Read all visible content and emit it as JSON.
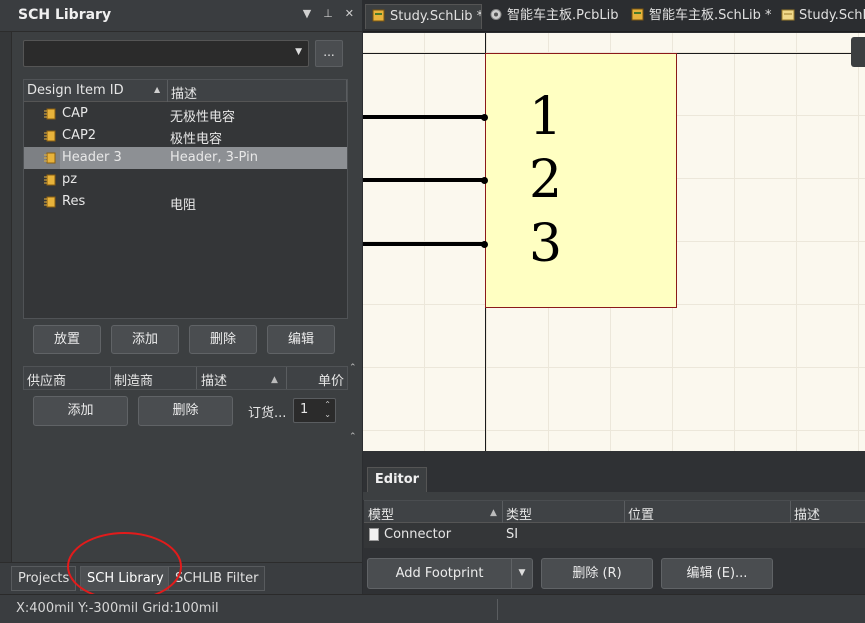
{
  "panel": {
    "title": "SCH Library",
    "title_icons": [
      "chevron-down-icon",
      "pin-icon",
      "close-icon"
    ],
    "filter_value": "",
    "browse_label": "...",
    "grid": {
      "headers": [
        "Design Item ID",
        "描述"
      ],
      "rows": [
        {
          "id": "CAP",
          "desc": "无极性电容"
        },
        {
          "id": "CAP2",
          "desc": "极性电容"
        },
        {
          "id": "Header 3",
          "desc": "Header, 3-Pin"
        },
        {
          "id": "pz",
          "desc": ""
        },
        {
          "id": "Res",
          "desc": "电阻"
        }
      ],
      "selected_index": 2
    },
    "actions": [
      "放置",
      "添加",
      "删除",
      "编辑"
    ],
    "supplier_headers": [
      "供应商",
      "制造商",
      "描述",
      "单价"
    ],
    "supplier_actions": [
      "添加",
      "删除"
    ],
    "order_label": "订货...",
    "order_qty": "1",
    "bottom_tabs": [
      "Projects",
      "SCH Library",
      "SCHLIB Filter"
    ],
    "active_bottom_tab": "SCH Library"
  },
  "status": {
    "text": "X:400mil Y:-300mil   Grid:100mil"
  },
  "doc_tabs": [
    {
      "label": "Study.SchLib *",
      "active": true
    },
    {
      "label": "智能车主板.PcbLib",
      "active": false
    },
    {
      "label": "智能车主板.SchLib *",
      "active": false
    },
    {
      "label": "Study.SchDoc",
      "active": false
    }
  ],
  "canvas": {
    "pins": [
      "1",
      "2",
      "3"
    ],
    "body_color": "#ffffc2",
    "border_color": "#8b1a1a"
  },
  "editor": {
    "tab": "Editor",
    "headers": [
      "模型",
      "类型",
      "位置",
      "描述"
    ],
    "row": {
      "model": "Connector",
      "type": "SI",
      "location": "",
      "desc": ""
    },
    "buttons": {
      "add_footprint": "Add Footprint",
      "delete": "删除 (R)",
      "edit": "编辑 (E)..."
    }
  },
  "colors": {
    "accent_annotation": "#e21b1b",
    "selection": "#8d9094"
  }
}
